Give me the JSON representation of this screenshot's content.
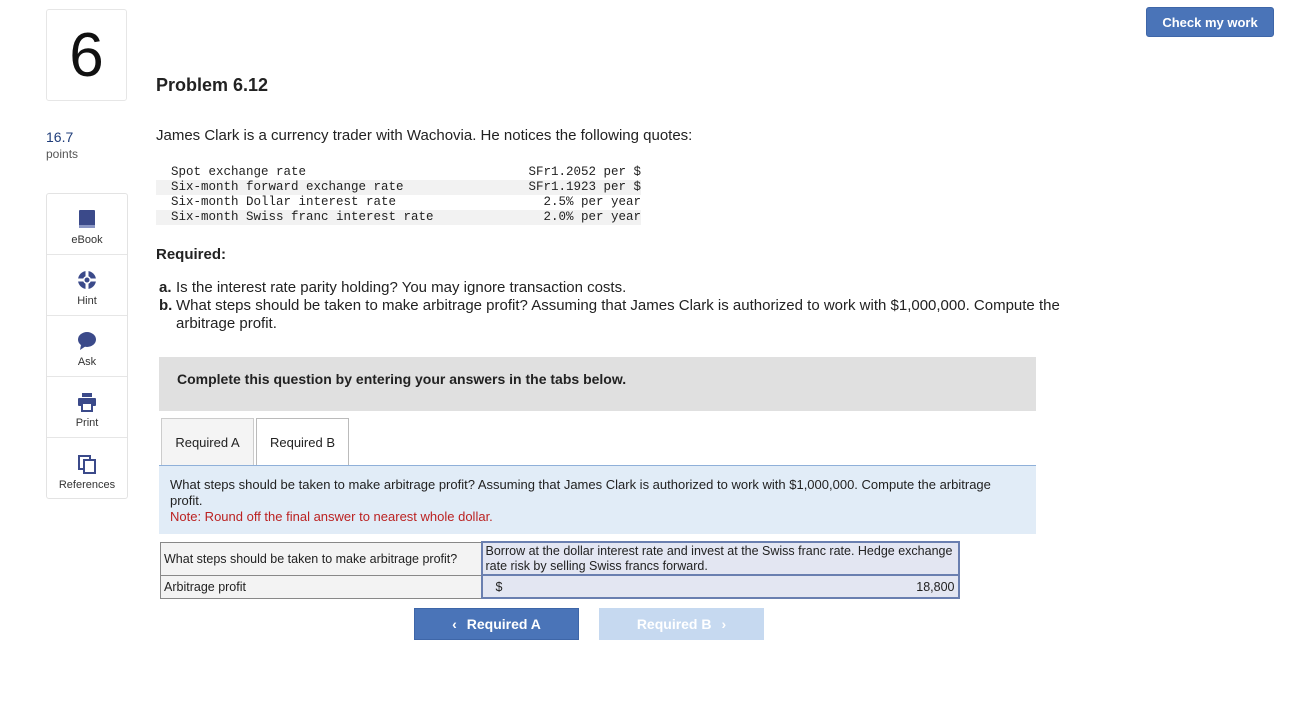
{
  "question_number": "6",
  "points": {
    "value": "16.7",
    "label": "points"
  },
  "tools": [
    {
      "label": "eBook",
      "icon": "ebook-icon"
    },
    {
      "label": "Hint",
      "icon": "hint-icon"
    },
    {
      "label": "Ask",
      "icon": "ask-icon"
    },
    {
      "label": "Print",
      "icon": "print-icon"
    },
    {
      "label": "References",
      "icon": "references-icon"
    }
  ],
  "check_button": "Check my work",
  "title": "Problem 6.12",
  "intro": "James Clark is a currency trader with Wachovia. He notices the following quotes:",
  "quotes": [
    {
      "label": "Spot exchange rate",
      "value": "SFr1.2052 per $"
    },
    {
      "label": "Six-month forward exchange rate",
      "value": "SFr1.1923 per $"
    },
    {
      "label": "Six-month Dollar interest rate",
      "value": "2.5% per year"
    },
    {
      "label": "Six-month Swiss franc interest rate",
      "value": "2.0% per year"
    }
  ],
  "required_heading": "Required:",
  "requirements": [
    {
      "letter": "a.",
      "text": "Is the interest rate parity holding? You may ignore transaction costs."
    },
    {
      "letter": "b.",
      "text": "What steps should be taken to make arbitrage profit? Assuming that James Clark is authorized to work with $1,000,000. Compute the arbitrage profit."
    }
  ],
  "complete_box": "Complete this question by entering your answers in the tabs below.",
  "tabs": [
    {
      "label": "Required A",
      "active": false
    },
    {
      "label": "Required B",
      "active": true
    }
  ],
  "question_text": "What steps should be taken to make arbitrage profit? Assuming that James Clark is authorized to work with $1,000,000. Compute the arbitrage profit.",
  "note": "Note: Round off the final answer to nearest whole dollar.",
  "answers": {
    "row1_label": "What steps should be taken to make arbitrage profit?",
    "row1_value": "Borrow at the dollar interest rate and invest at the Swiss franc rate. Hedge exchange rate risk by selling Swiss francs forward.",
    "row2_label": "Arbitrage profit",
    "currency": "$",
    "row2_value": "18,800"
  },
  "nav": {
    "prev": "Required A",
    "next": "Required B"
  },
  "colors": {
    "primary": "#4a74b8",
    "note": "#bb2222",
    "panel": "#e1ecf7"
  }
}
